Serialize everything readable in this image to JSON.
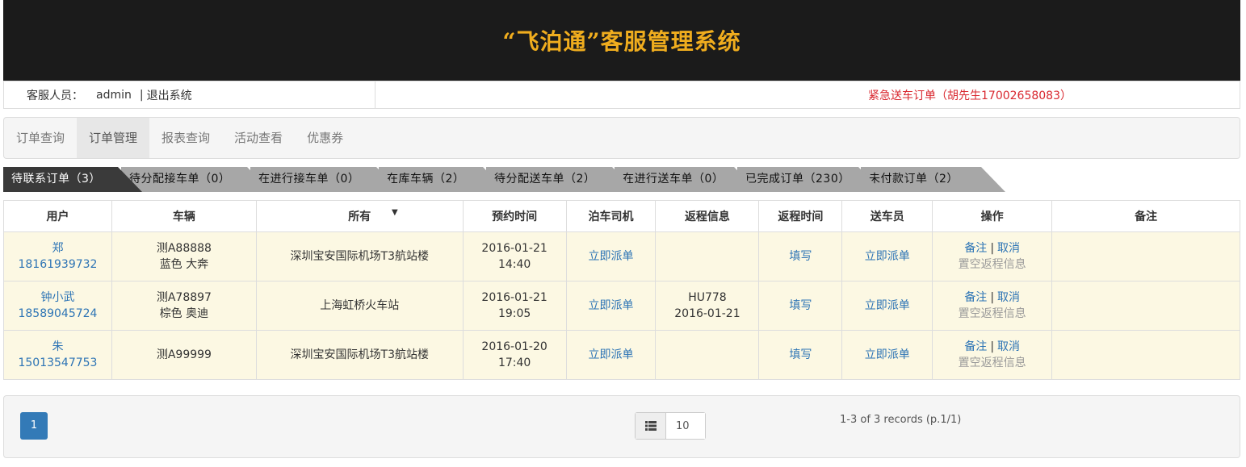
{
  "header": {
    "title": "“飞泊通”客服管理系统"
  },
  "infobar": {
    "staff_label": "客服人员：",
    "staff_name": "admin",
    "separator": "|",
    "logout": "退出系统",
    "urgent_notice": "紧急送车订单（胡先生17002658083）"
  },
  "nav": {
    "items": [
      {
        "label": "订单查询"
      },
      {
        "label": "订单管理"
      },
      {
        "label": "报表查询"
      },
      {
        "label": "活动查看"
      },
      {
        "label": "优惠券"
      }
    ],
    "active": "订单管理"
  },
  "tabs": [
    {
      "label": "待联系订单（3）"
    },
    {
      "label": "待分配接车单（0）"
    },
    {
      "label": "在进行接车单（0）"
    },
    {
      "label": "在库车辆（2）"
    },
    {
      "label": "待分配送车单（2）"
    },
    {
      "label": "在进行送车单（0）"
    },
    {
      "label": "已完成订单（230）"
    },
    {
      "label": "未付款订单（2）"
    }
  ],
  "table": {
    "columns": [
      "用户",
      "车辆",
      "所有",
      "预约时间",
      "泊车司机",
      "返程信息",
      "返程时间",
      "送车员",
      "操作",
      "备注"
    ],
    "sort_caret": "▼",
    "rows": [
      {
        "user_name": "郑",
        "user_phone": "18161939732",
        "vehicle_plate": "测A88888",
        "vehicle_desc": "蓝色 大奔",
        "location": "深圳宝安国际机场T3航站楼",
        "date": "2016-01-21",
        "time": "14:40",
        "driver": "立即派单",
        "return_flight": "",
        "return_date": "",
        "return_time": "填写",
        "deliverer": "立即派单",
        "op_note": "备注",
        "op_cancel": "取消",
        "op_clear": "置空返程信息",
        "remark": ""
      },
      {
        "user_name": "钟小武",
        "user_phone": "18589045724",
        "vehicle_plate": "测A78897",
        "vehicle_desc": "棕色 奥迪",
        "location": "上海虹桥火车站",
        "date": "2016-01-21",
        "time": "19:05",
        "driver": "立即派单",
        "return_flight": "HU778",
        "return_date": "2016-01-21",
        "return_time": "填写",
        "deliverer": "立即派单",
        "op_note": "备注",
        "op_cancel": "取消",
        "op_clear": "置空返程信息",
        "remark": ""
      },
      {
        "user_name": "朱",
        "user_phone": "15013547753",
        "vehicle_plate": "测A99999",
        "vehicle_desc": "",
        "location": "深圳宝安国际机场T3航站楼",
        "date": "2016-01-20",
        "time": "17:40",
        "driver": "立即派单",
        "return_flight": "",
        "return_date": "",
        "return_time": "填写",
        "deliverer": "立即派单",
        "op_note": "备注",
        "op_cancel": "取消",
        "op_clear": "置空返程信息",
        "remark": ""
      }
    ]
  },
  "pagination": {
    "current_page": "1",
    "page_size": "10",
    "page_size_icon": "list-icon",
    "records_text": "1-3 of 3 records (p.1/1)"
  },
  "colors": {
    "header_bg": "#1b1b1b",
    "title": "#f0ad1e",
    "urgent": "#d9282f",
    "link": "#2d74b5",
    "row_bg": "#fcf8e3",
    "tab_active": "#3a3a3a",
    "tab_inactive": "#a7a7a7",
    "page_btn": "#337ab7"
  }
}
